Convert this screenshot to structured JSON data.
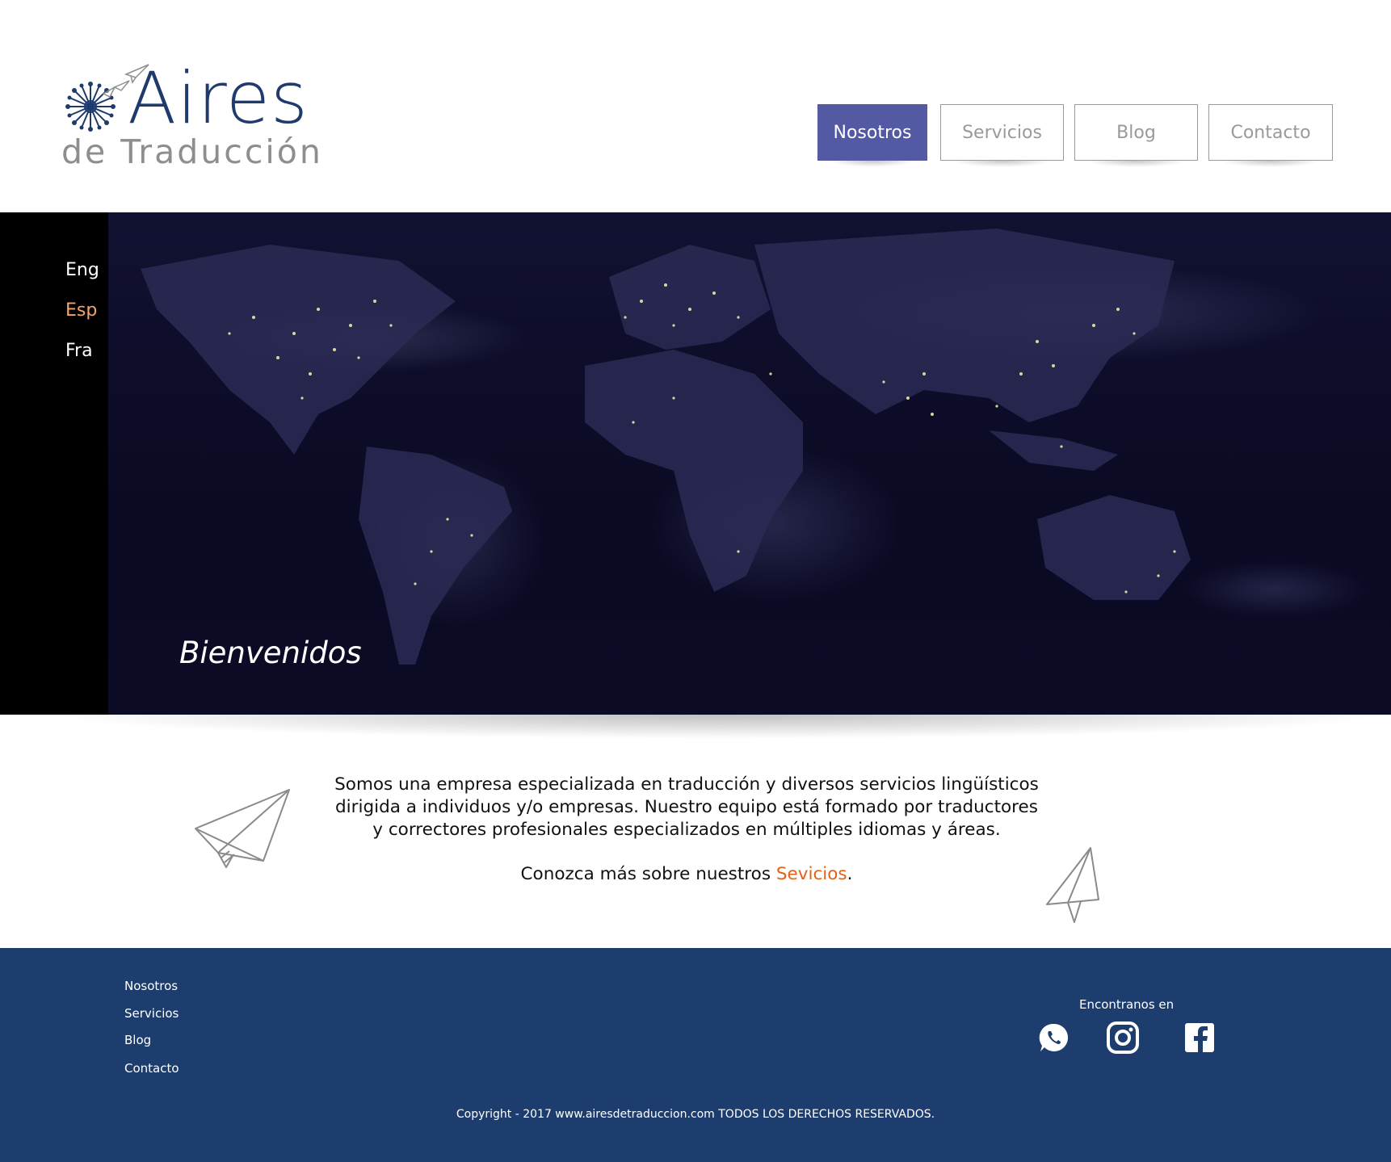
{
  "logo": {
    "name": "Aires",
    "subtitle": "de Traducción"
  },
  "nav": {
    "items": [
      {
        "label": "Nosotros",
        "active": true
      },
      {
        "label": "Servicios",
        "active": false
      },
      {
        "label": "Blog",
        "active": false
      },
      {
        "label": "Contacto",
        "active": false
      }
    ]
  },
  "languages": [
    {
      "label": "Eng",
      "active": false
    },
    {
      "label": "Esp",
      "active": true
    },
    {
      "label": "Fra",
      "active": false
    }
  ],
  "hero": {
    "welcome": "Bienvenidos"
  },
  "intro": {
    "lines": [
      "Somos una empresa especializada en traducción y diversos servicios lingüísticos",
      "dirigida a individuos y/o empresas. Nuestro equipo está formado por traductores",
      "y correctores profesionales especializados en múltiples idiomas y áreas."
    ],
    "more_prefix": "Conozca más sobre nuestros ",
    "more_link": "Sevicios",
    "more_suffix": "."
  },
  "footer": {
    "links": [
      "Nosotros",
      "Servicios",
      "Blog",
      "Contacto"
    ],
    "find_us": "Encontranos en",
    "social": [
      "whatsapp-icon",
      "instagram-icon",
      "facebook-icon"
    ],
    "copyright": "Copyright - 2017 www.airesdetraduccion.com TODOS LOS DERECHOS RESERVADOS."
  },
  "colors": {
    "brand_navy": "#1d3d6e",
    "nav_active": "#5459a3",
    "accent_orange": "#e2621b",
    "lang_active": "#f5a36c"
  }
}
